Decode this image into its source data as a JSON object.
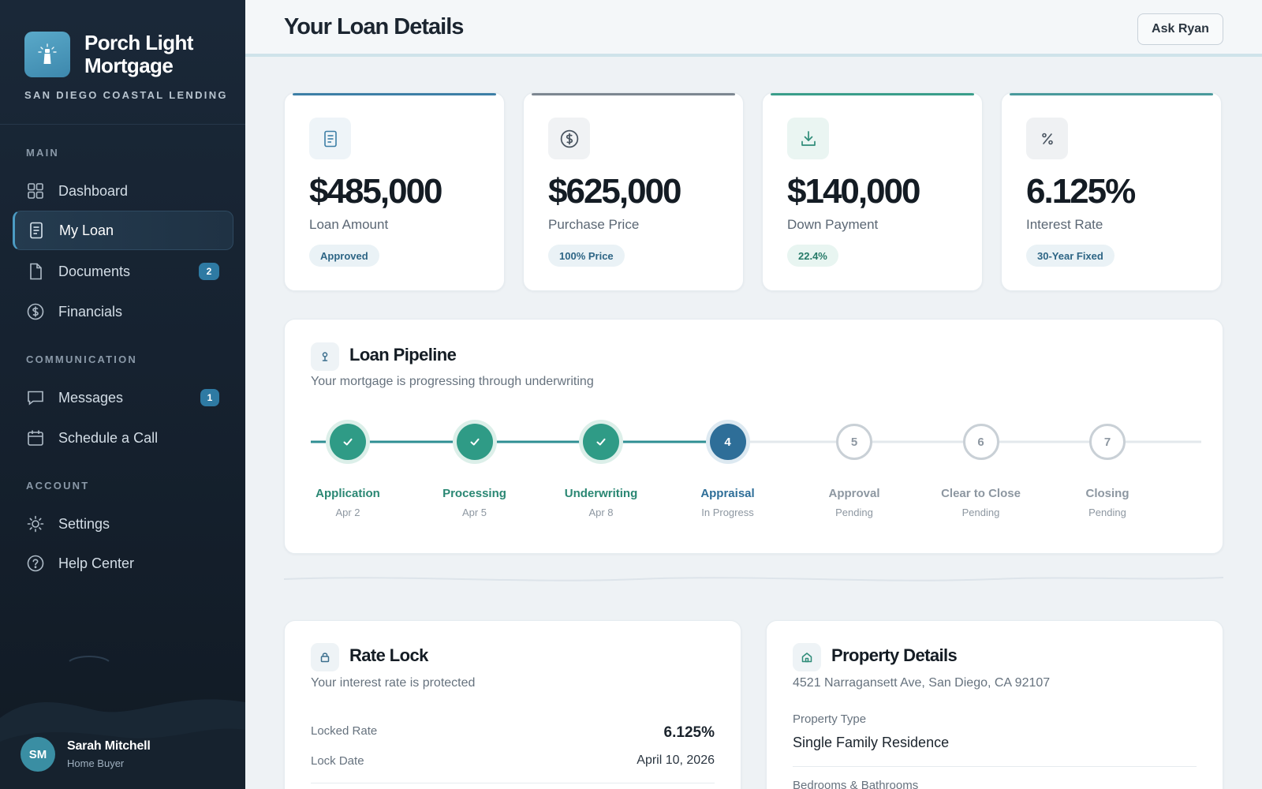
{
  "brand": {
    "name": "Porch Light Mortgage",
    "tagline": "SAN DIEGO COASTAL LENDING"
  },
  "nav": {
    "sections": {
      "main": "MAIN",
      "communication": "COMMUNICATION",
      "account": "ACCOUNT"
    },
    "items": [
      {
        "label": "Dashboard",
        "icon": "grid-icon"
      },
      {
        "label": "My Loan",
        "icon": "document-icon",
        "active": true
      },
      {
        "label": "Documents",
        "icon": "file-icon",
        "badge": "2"
      },
      {
        "label": "Financials",
        "icon": "dollar-circle-icon"
      },
      {
        "label": "Messages",
        "icon": "chat-icon",
        "badge": "1"
      },
      {
        "label": "Schedule a Call",
        "icon": "calendar-icon"
      },
      {
        "label": "Settings",
        "icon": "sun-gear-icon"
      },
      {
        "label": "Help Center",
        "icon": "question-circle-icon"
      }
    ]
  },
  "user": {
    "initials": "SM",
    "name": "Sarah Mitchell",
    "role": "Home Buyer"
  },
  "header": {
    "title": "Your Loan Details",
    "ask_button": "Ask Ryan"
  },
  "stats": [
    {
      "value": "$485,000",
      "label": "Loan Amount",
      "pill": "Approved",
      "icon": "document-icon",
      "accent": "#3d7fa6"
    },
    {
      "value": "$625,000",
      "label": "Purchase Price",
      "pill": "100% Price",
      "icon": "dollar-circle-icon",
      "accent": "#7d8791"
    },
    {
      "value": "$140,000",
      "label": "Down Payment",
      "pill": "22.4%",
      "icon": "download-icon",
      "accent": "#3a9e8a"
    },
    {
      "value": "6.125%",
      "label": "Interest Rate",
      "pill": "30-Year Fixed",
      "icon": "percent-icon",
      "accent": "#4a9a9c"
    }
  ],
  "pipeline": {
    "title": "Loan Pipeline",
    "subtitle": "Your mortgage is progressing through underwriting",
    "steps": [
      {
        "number": "1",
        "name": "Application",
        "date": "Apr 2",
        "status": "complete"
      },
      {
        "number": "2",
        "name": "Processing",
        "date": "Apr 5",
        "status": "complete"
      },
      {
        "number": "3",
        "name": "Underwriting",
        "date": "Apr 8",
        "status": "complete"
      },
      {
        "number": "4",
        "name": "Appraisal",
        "date": "In Progress",
        "status": "current"
      },
      {
        "number": "5",
        "name": "Approval",
        "date": "Pending",
        "status": "pending"
      },
      {
        "number": "6",
        "name": "Clear to Close",
        "date": "Pending",
        "status": "pending"
      },
      {
        "number": "7",
        "name": "Closing",
        "date": "Pending",
        "status": "pending"
      }
    ]
  },
  "rate_lock": {
    "title": "Rate Lock",
    "subtitle": "Your interest rate is protected",
    "rows": [
      {
        "label": "Locked Rate",
        "value": "6.125%"
      },
      {
        "label": "Lock Date",
        "value": "April 10, 2026"
      }
    ]
  },
  "property": {
    "title": "Property Details",
    "address": "4521 Narragansett Ave, San Diego, CA 92107",
    "type_label": "Property Type",
    "type_value": "Single Family Residence",
    "beds_label": "Bedrooms & Bathrooms"
  },
  "colors": {
    "teal": "#2f9b86",
    "blue": "#2e6e98",
    "pending": "#c9d0d6"
  }
}
